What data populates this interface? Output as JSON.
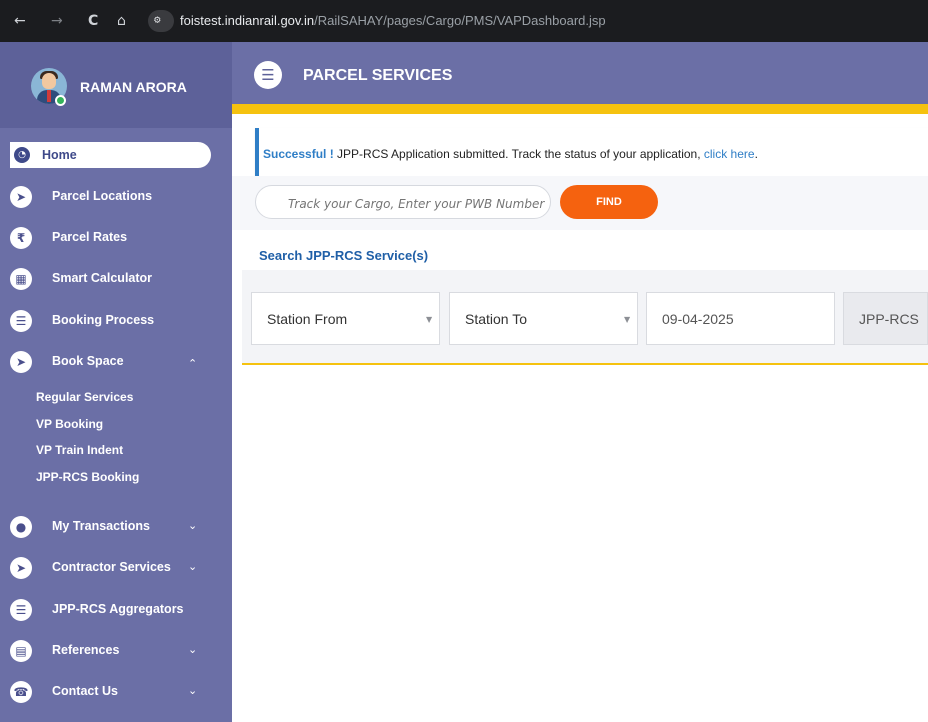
{
  "browser": {
    "back": "←",
    "forward": "→",
    "reload": "C",
    "home": "⌂",
    "site_info": "⚙",
    "url_host": "foistest.indianrail.gov.in",
    "url_path": "/RailSAHAY/pages/Cargo/PMS/VAPDashboard.jsp"
  },
  "user": {
    "name": "RAMAN ARORA"
  },
  "sidebar": {
    "home": {
      "label": "Home",
      "icon": "dashboard-icon"
    },
    "items": [
      {
        "label": "Parcel Locations",
        "icon": "location-arrow-icon",
        "glyph": "➤",
        "chevron": ""
      },
      {
        "label": "Parcel Rates",
        "icon": "rupee-icon",
        "glyph": "₹",
        "chevron": ""
      },
      {
        "label": "Smart Calculator",
        "icon": "calculator-icon",
        "glyph": "▦",
        "chevron": ""
      },
      {
        "label": "Booking Process",
        "icon": "list-icon",
        "glyph": "☰",
        "chevron": ""
      },
      {
        "label": "Book Space",
        "icon": "location-arrow-icon",
        "glyph": "➤",
        "chevron": "⌃"
      },
      {
        "label": "My Transactions",
        "icon": "user-circle-icon",
        "glyph": "●",
        "chevron": "⌄"
      },
      {
        "label": "Contractor Services",
        "icon": "location-arrow-icon",
        "glyph": "➤",
        "chevron": "⌄"
      },
      {
        "label": "JPP-RCS Aggregators",
        "icon": "list-icon",
        "glyph": "☰",
        "chevron": ""
      },
      {
        "label": "References",
        "icon": "document-icon",
        "glyph": "▤",
        "chevron": "⌄"
      },
      {
        "label": "Contact Us",
        "icon": "phone-icon",
        "glyph": "☎",
        "chevron": "⌄"
      }
    ],
    "book_space_sub": [
      "Regular Services",
      "VP Booking",
      "VP Train Indent",
      "JPP-RCS Booking"
    ]
  },
  "header": {
    "menu_icon": "☰",
    "title": "PARCEL SERVICES"
  },
  "alert": {
    "strong": "Successful !",
    "message": " JPP-RCS Application submitted. Track the status of your application, ",
    "link": "click here",
    "end": "."
  },
  "track": {
    "placeholder": "Track your Cargo, Enter your PWB Number",
    "button": "FIND"
  },
  "search": {
    "title": "Search JPP-RCS Service(s)",
    "station_from": "Station From",
    "station_to": "Station To",
    "date": "09-04-2025",
    "service": "JPP-RCS",
    "caret": "▼"
  },
  "colors": {
    "sidebar": "#6b6fa6",
    "accent_gold": "#f5c20f",
    "find_button": "#f5620f",
    "link_blue": "#2f7ec6"
  }
}
